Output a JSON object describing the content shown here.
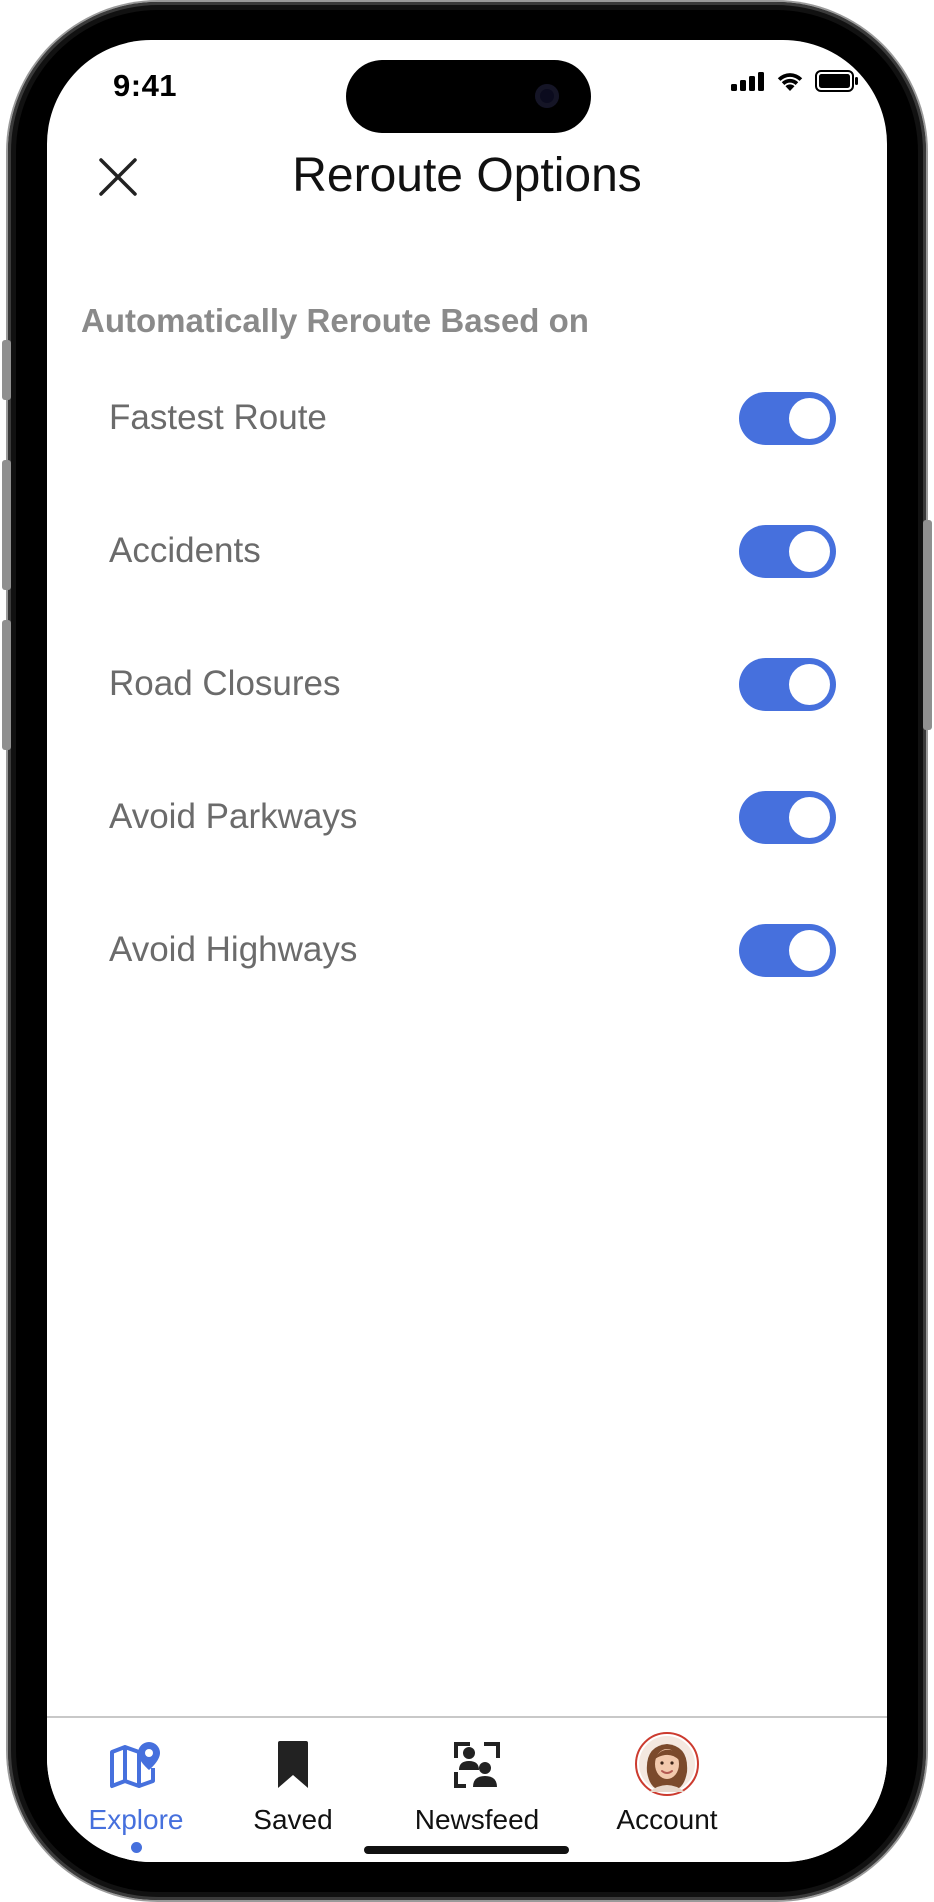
{
  "status_bar": {
    "time": "9:41",
    "icons": [
      "cellular-signal-icon",
      "wifi-icon",
      "battery-icon"
    ]
  },
  "header": {
    "title": "Reroute Options",
    "close_icon": "close-icon"
  },
  "section": {
    "label": "Automatically Reroute Based on",
    "options": [
      {
        "label": "Fastest Route",
        "enabled": true
      },
      {
        "label": "Accidents",
        "enabled": true
      },
      {
        "label": "Road Closures",
        "enabled": true
      },
      {
        "label": "Avoid Parkways",
        "enabled": true
      },
      {
        "label": "Avoid Highways",
        "enabled": true
      }
    ]
  },
  "tab_bar": {
    "tabs": [
      {
        "label": "Explore",
        "icon": "map-pin-icon",
        "active": true
      },
      {
        "label": "Saved",
        "icon": "bookmark-icon",
        "active": false
      },
      {
        "label": "Newsfeed",
        "icon": "people-frame-icon",
        "active": false
      },
      {
        "label": "Account",
        "icon": "avatar",
        "active": false
      }
    ]
  },
  "colors": {
    "accent": "#4670dd",
    "toggle_on": "#4670dd",
    "label_text": "#6b6b6b",
    "section_label": "#8a8a8a"
  }
}
